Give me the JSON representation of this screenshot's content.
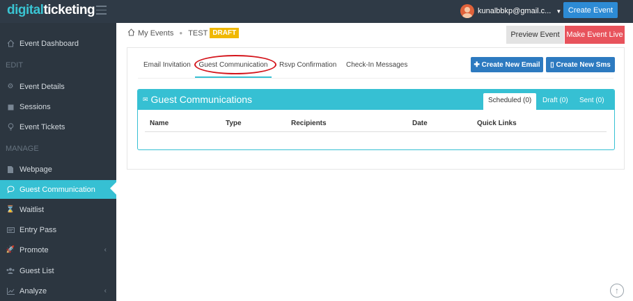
{
  "app": {
    "logo_part1": "digital",
    "logo_part2": "ticketing"
  },
  "header": {
    "user_email": "kunalbbkp@gmail.c...",
    "create_event_label": "Create Event"
  },
  "sidebar": {
    "dashboard": "Event Dashboard",
    "edit_heading": "EDIT",
    "event_details": "Event Details",
    "sessions": "Sessions",
    "event_tickets": "Event Tickets",
    "manage_heading": "MANAGE",
    "webpage": "Webpage",
    "guest_communication": "Guest Communication",
    "waitlist": "Waitlist",
    "entry_pass": "Entry Pass",
    "promote": "Promote",
    "guest_list": "Guest List",
    "analyze": "Analyze"
  },
  "breadcrumb": {
    "my_events": "My Events",
    "event_name": "TEST",
    "status": "DRAFT"
  },
  "actions": {
    "preview": "Preview Event",
    "make_live": "Make Event Live"
  },
  "tabs": {
    "email_invitation": "Email Invitation",
    "guest_communication": "Guest Communication",
    "rsvp_confirmation": "Rsvp Confirmation",
    "checkin_messages": "Check-In Messages"
  },
  "buttons": {
    "create_email": "Create New Email",
    "create_sms": "Create New Sms"
  },
  "panel": {
    "title": "Guest Communications",
    "tab_scheduled": "Scheduled (0)",
    "tab_draft": "Draft (0)",
    "tab_sent": "Sent (0)",
    "columns": {
      "name": "Name",
      "type": "Type",
      "recipients": "Recipients",
      "date": "Date",
      "quick_links": "Quick Links"
    }
  },
  "colors": {
    "accent": "#36c0d3",
    "topbar": "#2f3a46",
    "sidebar": "#2c3640",
    "primary_button": "#2d7ac0",
    "danger": "#e8535c",
    "draft": "#f0b800",
    "annotation": "#d4141b"
  }
}
